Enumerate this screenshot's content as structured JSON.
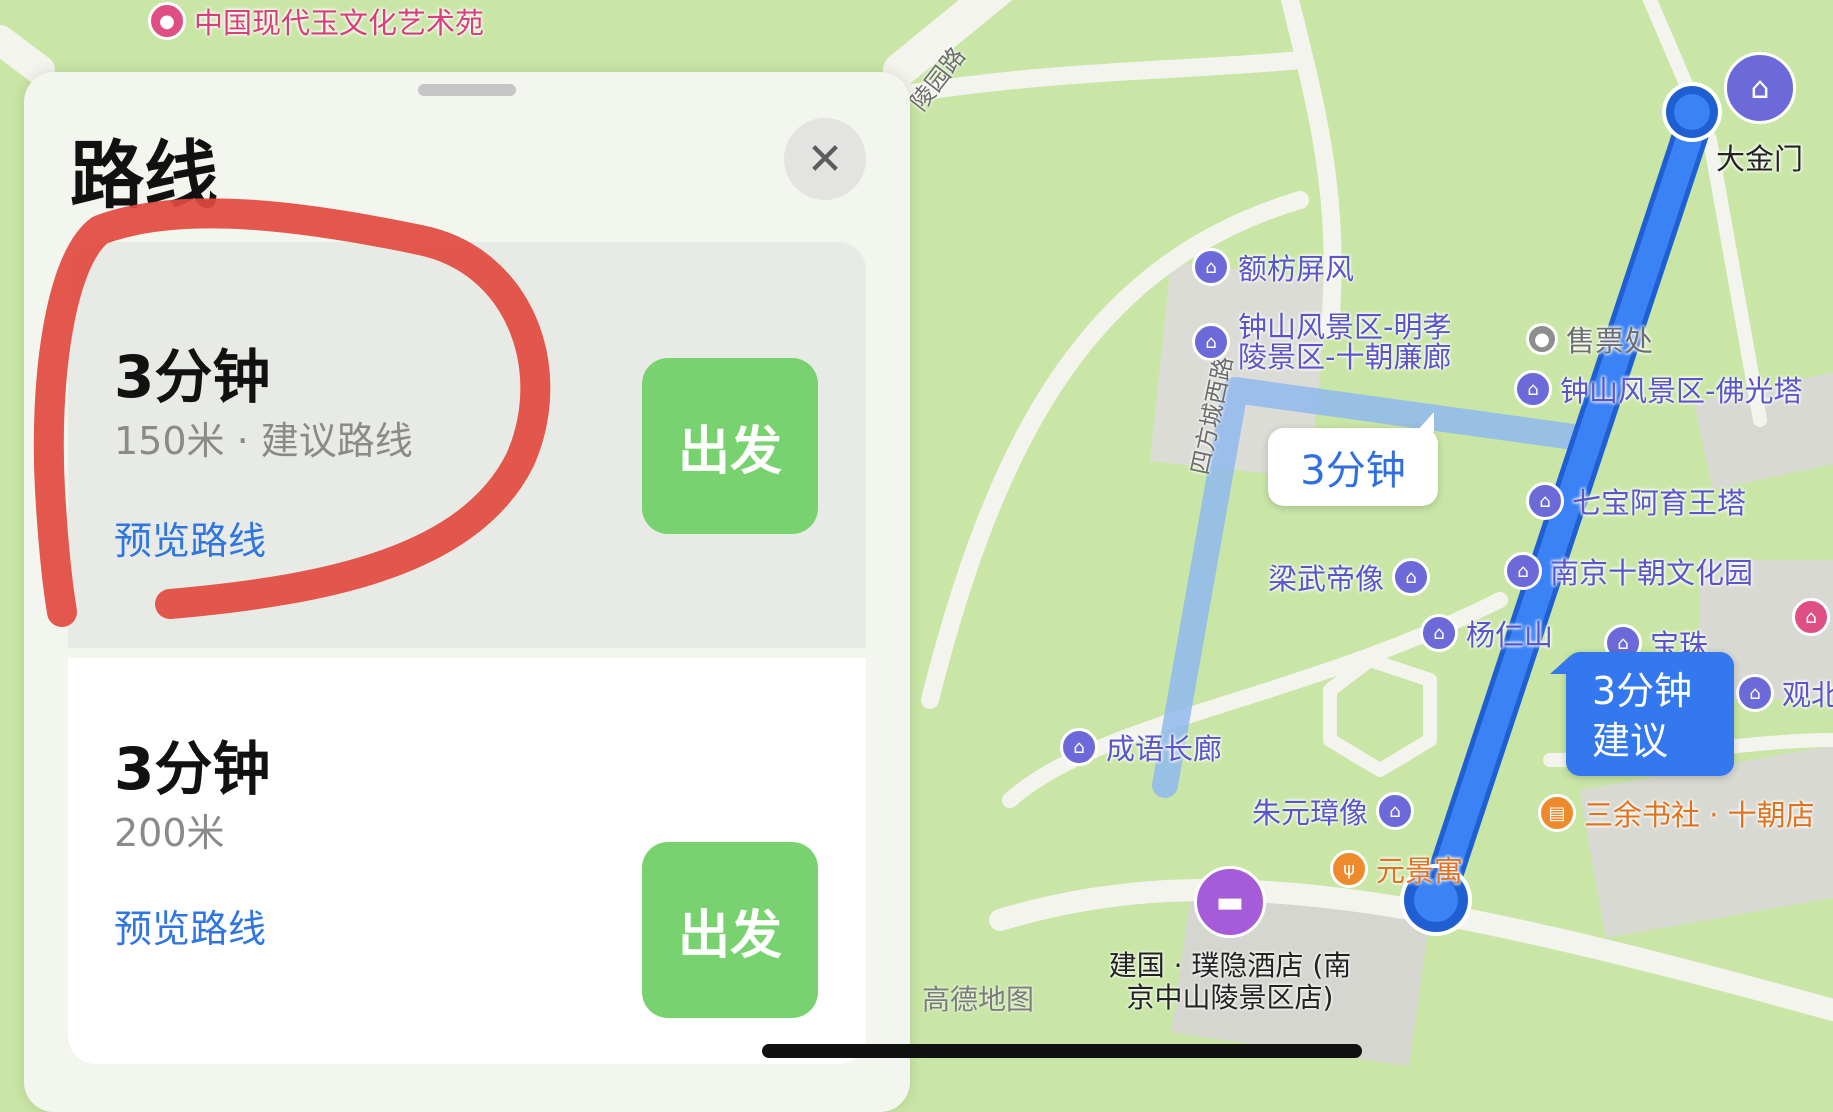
{
  "map": {
    "pois": {
      "jade_park": "中国现代玉文化艺术苑",
      "efang": "额枋屏风",
      "zhongshan_ming": "钟山风景区-明孝\n陵景区-十朝廉廊",
      "ticket": "售票处",
      "foguang": "钟山风景区-佛光塔",
      "qibao": "七宝阿育王塔",
      "nanjing_shichao": "南京十朝文化园",
      "liangwu": "梁武帝像",
      "yangren": "杨仁山",
      "baozhu": "宝珠",
      "guanbei": "观北",
      "chengyu": "成语长廊",
      "zhuyuanzhang": "朱元璋像",
      "sanyu": "三余书社 · 十朝店",
      "yuanjing": "元景寓",
      "dajinmen": "大金门",
      "hotel": "建国 · 璞隐酒店 (南\n京中山陵景区店)"
    },
    "roads": {
      "lingyuan": "陵园路",
      "sifang": "四方城西路"
    },
    "callouts": {
      "alt_time": "3分钟",
      "suggested_time": "3分钟",
      "suggested_label": "建议"
    },
    "watermark": "高德地图",
    "colors": {
      "route_primary": "#3478f0",
      "route_alt": "#8fb8ef",
      "park": "#c9e6a6",
      "road": "#f2f2ee"
    }
  },
  "sheet": {
    "title": "路线",
    "close_icon": "close-icon",
    "routes": [
      {
        "time": "3分钟",
        "detail": "150米 · 建议路线",
        "preview": "预览路线",
        "go": "出发"
      },
      {
        "time": "3分钟",
        "detail": "200米",
        "preview": "预览路线",
        "go": "出发"
      }
    ]
  }
}
